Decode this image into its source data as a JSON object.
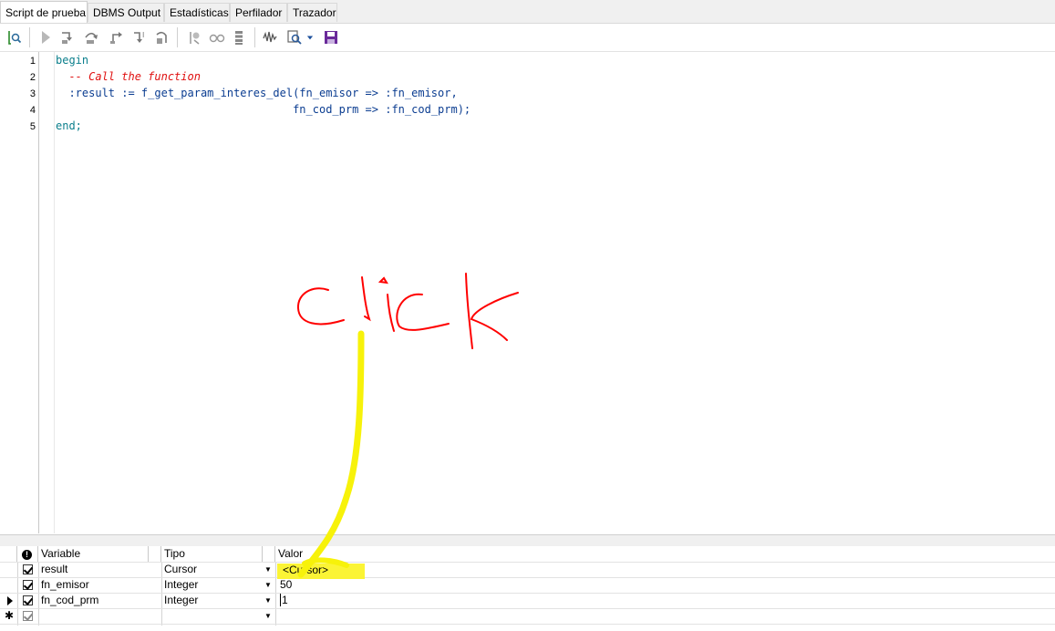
{
  "tabs": [
    {
      "label": "Script de prueba",
      "active": true
    },
    {
      "label": "DBMS Output",
      "active": false
    },
    {
      "label": "Estadísticas",
      "active": false
    },
    {
      "label": "Perfilador",
      "active": false
    },
    {
      "label": "Trazador",
      "active": false
    }
  ],
  "toolbar": {
    "icons": [
      "execute-script-icon",
      "run-icon",
      "step-into-icon",
      "step-over-icon",
      "step-out-icon",
      "run-to-exception-icon",
      "run-to-next-icon",
      "toggle-breakpoint-icon",
      "watch-icon",
      "stack-icon",
      "profile-icon",
      "search-icon",
      "dropdown-icon",
      "save-icon"
    ]
  },
  "editor": {
    "line_numbers": [
      "1",
      "2",
      "3",
      "4",
      "5"
    ],
    "lines": [
      {
        "kw": "begin"
      },
      {
        "comment": "  -- Call the function"
      },
      {
        "text": "  :result := f_get_param_interes_del(fn_emisor => :fn_emisor,"
      },
      {
        "text": "                                    fn_cod_prm => :fn_cod_prm);"
      },
      {
        "kw": "end;"
      }
    ]
  },
  "annotation": {
    "handwritten_text": "click",
    "ink_color": "#ff0000",
    "arrow_color": "#f7f20a"
  },
  "grid": {
    "columns": {
      "info": "!",
      "variable": "Variable",
      "tipo": "Tipo",
      "valor": "Valor"
    },
    "rows": [
      {
        "checked": true,
        "variable": "result",
        "tipo": "Cursor",
        "valor": "<Cursor>",
        "current": false
      },
      {
        "checked": true,
        "variable": "fn_emisor",
        "tipo": "Integer",
        "valor": "50",
        "current": false
      },
      {
        "checked": true,
        "variable": "fn_cod_prm",
        "tipo": "Integer",
        "valor": "1",
        "current": true
      }
    ],
    "new_row_marker": "✱"
  },
  "colors": {
    "keyword": "#0b7f8c",
    "comment": "#e01010",
    "highlight": "#fbf32a"
  }
}
